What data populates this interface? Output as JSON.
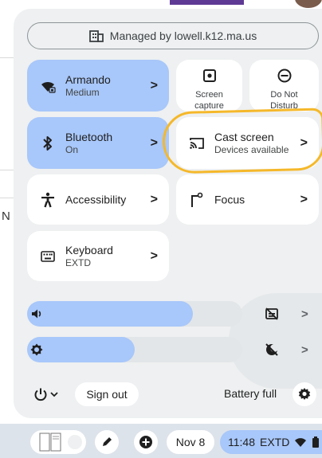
{
  "managed_banner": "Managed by lowell.k12.ma.us",
  "tiles": {
    "wifi": {
      "title": "Armando",
      "subtitle": "Medium"
    },
    "bluetooth": {
      "title": "Bluetooth",
      "subtitle": "On"
    },
    "cast": {
      "title": "Cast screen",
      "subtitle": "Devices available"
    },
    "accessibility": {
      "title": "Accessibility"
    },
    "focus": {
      "title": "Focus"
    },
    "keyboard": {
      "title": "Keyboard",
      "subtitle": "EXTD"
    },
    "screen_capture": {
      "line1": "Screen",
      "line2": "capture"
    },
    "do_not_disturb": {
      "line1": "Do Not",
      "line2": "Disturb"
    }
  },
  "chevron": ">",
  "sliders": {
    "volume_level": 0.77,
    "brightness_level": 0.5
  },
  "footer": {
    "sign_out": "Sign out",
    "battery": "Battery full"
  },
  "shelf": {
    "date": "Nov 8",
    "time": "11:48",
    "keyboard_layout": "EXTD"
  },
  "background_letter": "N",
  "colors": {
    "accent": "#a8c7fa",
    "panel": "#eef0f1",
    "highlight": "#f5b82a"
  }
}
